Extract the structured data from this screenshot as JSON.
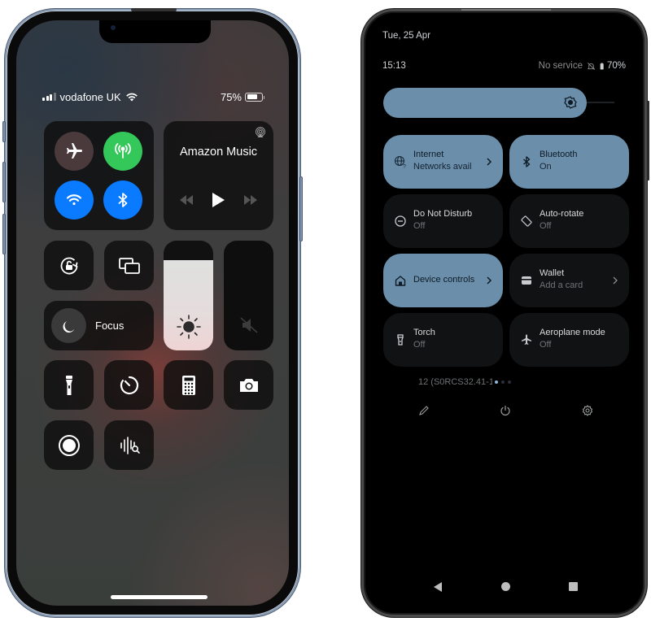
{
  "iphone": {
    "status_bar": {
      "carrier": "vodafone UK",
      "signal_bars": 3,
      "signal_bars_total": 4,
      "battery_percent": "75%",
      "battery_level": 0.75
    },
    "connectivity": {
      "airplane_mode": {
        "icon": "airplane-icon",
        "state": "off"
      },
      "cellular_data": {
        "icon": "antenna-icon",
        "state": "on",
        "color": "#34c759"
      },
      "wifi": {
        "icon": "wifi-icon",
        "state": "on",
        "color": "#0a7aff"
      },
      "bluetooth": {
        "icon": "bluetooth-icon",
        "state": "on",
        "color": "#0a7aff"
      }
    },
    "now_playing": {
      "app_title": "Amazon Music",
      "controls": [
        "rewind-icon",
        "play-icon",
        "fast-forward-icon"
      ],
      "airplay_icon": "airplay-icon"
    },
    "tiles": {
      "orientation_lock": {
        "icon": "rotation-lock-icon"
      },
      "screen_mirroring": {
        "icon": "screen-mirroring-icon"
      },
      "focus": {
        "label": "Focus",
        "icon": "moon-icon"
      },
      "brightness": {
        "icon": "sun-icon",
        "level": 0.82
      },
      "volume": {
        "icon": "speaker-muted-icon",
        "level": 0.0
      },
      "flashlight": {
        "icon": "flashlight-icon"
      },
      "timer": {
        "icon": "timer-icon"
      },
      "calculator": {
        "icon": "calculator-icon"
      },
      "camera": {
        "icon": "camera-icon"
      },
      "screen_recording": {
        "icon": "record-icon"
      },
      "sound_recognition": {
        "icon": "sound-recognition-icon"
      }
    }
  },
  "android": {
    "date": "Tue, 25 Apr",
    "time": "15:13",
    "service": "No service",
    "battery": "70%",
    "brightness_level": 0.85,
    "brightness_color": "#6b8fab",
    "tiles": [
      {
        "title": "Internet",
        "subtitle": "Networks avail",
        "state": "on",
        "icon": "globe-question-icon",
        "has_chevron": true
      },
      {
        "title": "Bluetooth",
        "subtitle": "On",
        "state": "on",
        "icon": "bluetooth-icon",
        "has_chevron": false
      },
      {
        "title": "Do Not Disturb",
        "subtitle": "Off",
        "state": "off",
        "icon": "do-not-disturb-icon",
        "has_chevron": false
      },
      {
        "title": "Auto-rotate",
        "subtitle": "Off",
        "state": "off",
        "icon": "auto-rotate-icon",
        "has_chevron": false
      },
      {
        "title": "Device controls",
        "subtitle": "",
        "state": "on",
        "icon": "home-icon",
        "has_chevron": true
      },
      {
        "title": "Wallet",
        "subtitle": "Add a card",
        "state": "off",
        "icon": "wallet-icon",
        "has_chevron": true
      },
      {
        "title": "Torch",
        "subtitle": "Off",
        "state": "off",
        "icon": "torch-icon",
        "has_chevron": false
      },
      {
        "title": "Aeroplane mode",
        "subtitle": "Off",
        "state": "off",
        "icon": "aeroplane-icon",
        "has_chevron": false
      }
    ],
    "build_number": "12 (S0RCS32.41-1",
    "page_indicator": {
      "current": 1,
      "total": 3
    },
    "footer_buttons": [
      "edit-icon",
      "power-icon",
      "settings-icon"
    ],
    "nav_bar": [
      "back",
      "home",
      "recents"
    ]
  }
}
